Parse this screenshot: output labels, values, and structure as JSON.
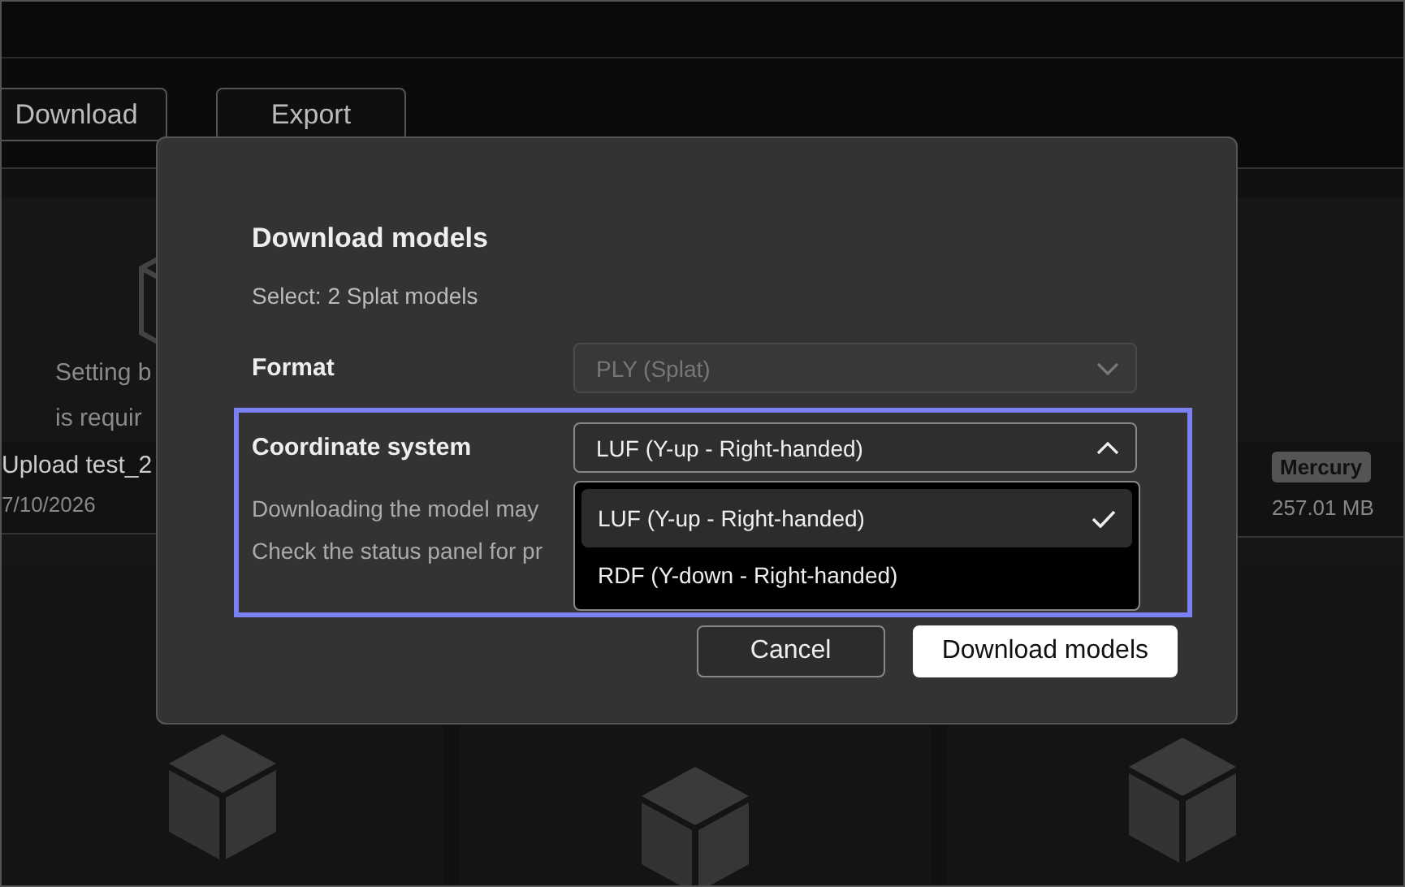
{
  "toolbar": {
    "buttons": [
      "Download",
      "Export"
    ]
  },
  "cards": {
    "empty_message": [
      "Setting b",
      "is requir"
    ],
    "upload": {
      "name": "Upload test_2",
      "date": "7/10/2026"
    },
    "model": {
      "tag": "Mercury",
      "size": "257.01 MB"
    }
  },
  "dialog": {
    "title": "Download models",
    "subtitle": "Select: 2 Splat models",
    "fields": [
      {
        "label": "Format",
        "value": "PLY (Splat)",
        "disabled": true,
        "expanded": false,
        "focused": false
      },
      {
        "label": "Coordinate system",
        "value": "LUF (Y-up - Right-handed)",
        "disabled": false,
        "expanded": true,
        "focused": true,
        "options": [
          {
            "label": "LUF (Y-up - Right-handed)",
            "selected": true
          },
          {
            "label": "RDF (Y-down - Right-handed)",
            "selected": false
          }
        ]
      }
    ],
    "notes": [
      "Downloading the model may",
      "Check the status panel for pr"
    ],
    "buttons": [
      {
        "label": "Cancel",
        "kind": "secondary"
      },
      {
        "label": "Download models",
        "kind": "primary"
      }
    ]
  }
}
